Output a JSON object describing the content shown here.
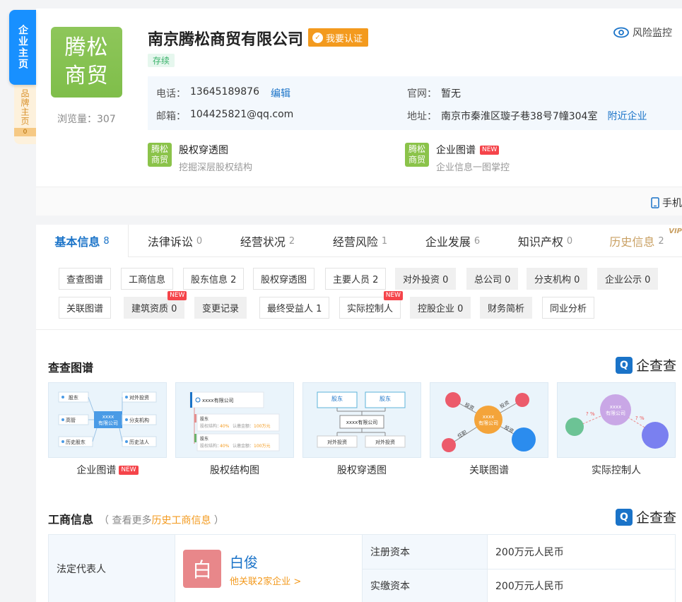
{
  "side": {
    "main_tab": "企业主页",
    "brand_tab": "品牌主页",
    "brand_count": "0"
  },
  "company": {
    "logo_line1": "腾松",
    "logo_line2": "商贸",
    "views": "浏览量：307",
    "name": "南京腾松商贸有限公司",
    "certify": "我要认证",
    "status": "存续",
    "risk_monitor": "风险监控",
    "phone_label": "电话：",
    "phone": "13645189876",
    "edit": "编辑",
    "website_label": "官网：",
    "website": "暂无",
    "email_label": "邮箱：",
    "email": "104425821@qq.com",
    "address_label": "地址：",
    "address": "南京市秦淮区璇子巷38号7幢304室",
    "nearby": "附近企业"
  },
  "features": [
    {
      "title": "股权穿透图",
      "sub": "挖掘深层股权结构",
      "new": ""
    },
    {
      "title": "企业图谱",
      "sub": "企业信息一图掌控",
      "new": "NEW"
    }
  ],
  "mobile": "手机",
  "tabs": [
    {
      "label": "基本信息",
      "count": "8"
    },
    {
      "label": "法律诉讼",
      "count": "0"
    },
    {
      "label": "经营状况",
      "count": "2"
    },
    {
      "label": "经营风险",
      "count": "1"
    },
    {
      "label": "企业发展",
      "count": "6"
    },
    {
      "label": "知识产权",
      "count": "0"
    },
    {
      "label": "历史信息",
      "count": "2"
    }
  ],
  "vip": "VIP",
  "subtabs": [
    {
      "label": "查查图谱",
      "new": ""
    },
    {
      "label": "工商信息",
      "new": ""
    },
    {
      "label": "股东信息 2",
      "new": ""
    },
    {
      "label": "股权穿透图",
      "new": ""
    },
    {
      "label": "主要人员 2",
      "new": ""
    },
    {
      "label": "对外投资 0",
      "new": ""
    },
    {
      "label": "总公司 0",
      "new": ""
    },
    {
      "label": "分支机构 0",
      "new": ""
    },
    {
      "label": "企业公示 0",
      "new": ""
    },
    {
      "label": "关联图谱",
      "new": ""
    },
    {
      "label": "建筑资质 0",
      "new": "NEW"
    },
    {
      "label": "变更记录",
      "new": ""
    },
    {
      "label": "最终受益人 1",
      "new": ""
    },
    {
      "label": "实际控制人",
      "new": "NEW"
    },
    {
      "label": "控股企业 0",
      "new": ""
    },
    {
      "label": "财务简析",
      "new": ""
    },
    {
      "label": "同业分析",
      "new": ""
    }
  ],
  "graph_section": {
    "title": "查查图谱",
    "brand": "企查查",
    "brand_icon": "Q",
    "cards": [
      {
        "label": "企业图谱",
        "new": "NEW"
      },
      {
        "label": "股权结构图",
        "new": ""
      },
      {
        "label": "股权穿透图",
        "new": ""
      },
      {
        "label": "关联图谱",
        "new": ""
      },
      {
        "label": "实际控制人",
        "new": ""
      }
    ],
    "thumb1": {
      "center_line1": "xxxx",
      "center_line2": "有限公司",
      "n1": "股东",
      "n2": "对外投资",
      "n3": "高管",
      "n4": "分支机构",
      "n5": "历史股东",
      "n6": "历史法人"
    },
    "thumb2": {
      "head": "xxxx有限公司",
      "row_title": "股东",
      "row_meta1": "股权结构：",
      "row_pct": "40%",
      "row_meta2": "认缴金额：",
      "row_amt": "100万元"
    },
    "thumb3": {
      "top": "股东",
      "mid": "xxxx有限公司",
      "bottom": "对外投资"
    },
    "thumb4": {
      "center_line1": "xxxx",
      "center_line2": "有限公司",
      "e1": "投资",
      "e2": "投资",
      "e3": "任职",
      "e4": "投资"
    },
    "thumb5": {
      "center_line1": "xxxx",
      "center_line2": "有限公司",
      "q": "? %"
    }
  },
  "biz_section": {
    "title": "工商信息",
    "more_prefix": "（ 查看更多",
    "more_link": "历史工商信息",
    "more_suffix": " ）",
    "brand": "企查查",
    "legal_rep_label": "法定代表人",
    "avatar_char": "白",
    "rep_name": "白俊",
    "rep_related": "他关联2家企业 >",
    "reg_capital_label": "注册资本",
    "reg_capital": "200万元人民币",
    "paid_capital_label": "实缴资本",
    "paid_capital": "200万元人民币"
  },
  "colors": {
    "primary": "#1890ff",
    "logo_green": "#8bc34a",
    "accent_orange": "#f39a1e",
    "new_red": "#f5444a"
  }
}
